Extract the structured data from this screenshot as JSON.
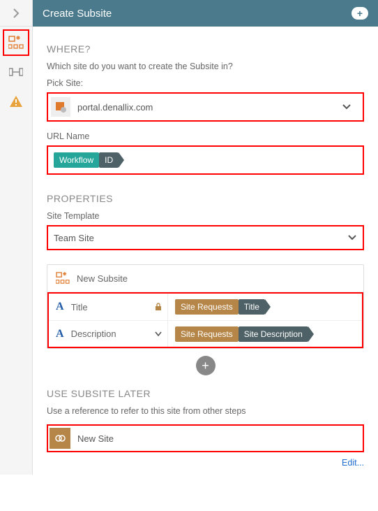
{
  "header": {
    "title": "Create Subsite",
    "plus": "+"
  },
  "where": {
    "heading": "WHERE?",
    "helper": "Which site do you want to create the Subsite in?",
    "pick_label": "Pick Site:",
    "site_value": "portal.denallix.com",
    "url_label": "URL Name",
    "url_tag_main": "Workflow",
    "url_tag_sub": "ID"
  },
  "properties": {
    "heading": "PROPERTIES",
    "template_label": "Site Template",
    "template_value": "Team Site",
    "card_title": "New Subsite",
    "rows": [
      {
        "label": "Title",
        "tag_a": "Site Requests",
        "tag_b": "Title",
        "locked": true
      },
      {
        "label": "Description",
        "tag_a": "Site Requests",
        "tag_b": "Site Description",
        "locked": false
      }
    ]
  },
  "later": {
    "heading": "USE SUBSITE LATER",
    "helper": "Use a reference to refer to this site from other steps",
    "ref_value": "New Site",
    "edit": "Edit..."
  }
}
